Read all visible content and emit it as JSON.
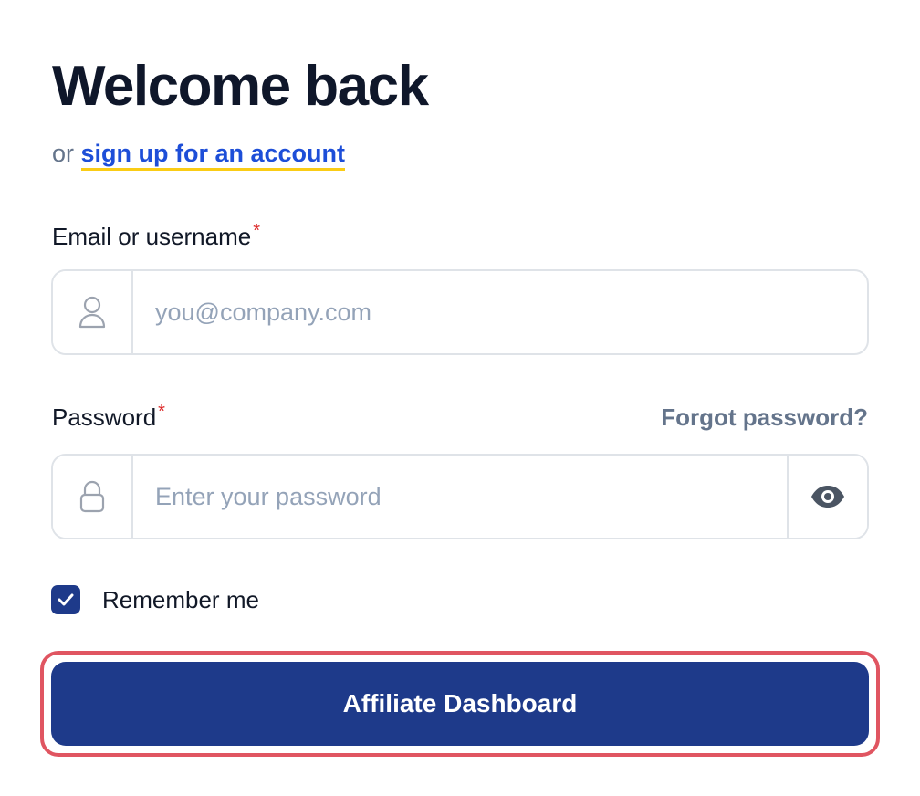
{
  "header": {
    "title": "Welcome back",
    "subtitle_prefix": "or ",
    "signup_link": "sign up for an account"
  },
  "email": {
    "label": "Email or username",
    "required_mark": "*",
    "placeholder": "you@company.com",
    "value": "",
    "icon": "user-icon"
  },
  "password": {
    "label": "Password",
    "required_mark": "*",
    "placeholder": "Enter your password",
    "value": "",
    "icon": "lock-icon",
    "toggle_icon": "eye-icon",
    "forgot_link": "Forgot password?"
  },
  "remember": {
    "label": "Remember me",
    "checked": true
  },
  "submit": {
    "label": "Affiliate Dashboard",
    "highlight_color": "#e05561"
  },
  "colors": {
    "primary": "#1e3a8a",
    "link": "#1d4ed8",
    "link_underline": "#facc15",
    "required": "#dc2626",
    "muted": "#64748b",
    "border": "#dfe3e8",
    "placeholder": "#94a3b8"
  }
}
